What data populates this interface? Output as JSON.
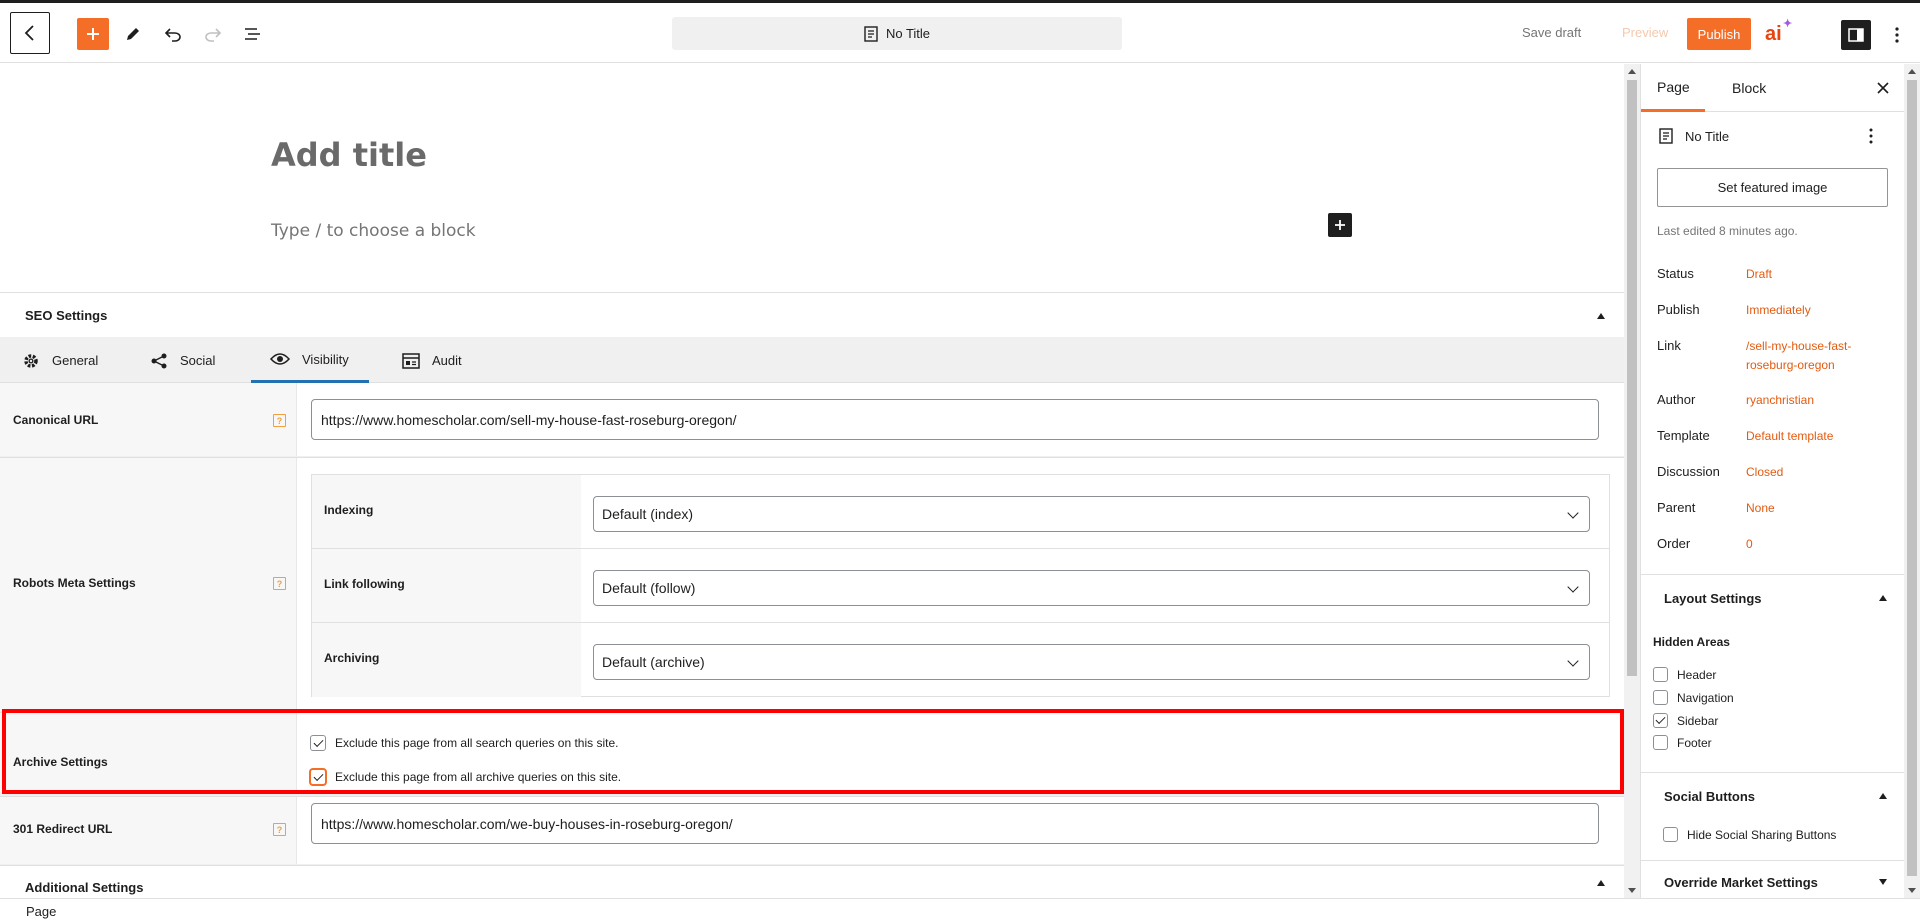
{
  "header": {
    "document_title": "No Title",
    "save_draft": "Save draft",
    "preview": "Preview",
    "publish": "Publish",
    "ai_logo": "ai",
    "accent_color": "#f56e28"
  },
  "editor": {
    "title_placeholder": "Add title",
    "block_placeholder": "Type / to choose a block"
  },
  "seo": {
    "section_title": "SEO Settings",
    "tabs": [
      {
        "label": "General",
        "icon": "gear-icon"
      },
      {
        "label": "Social",
        "icon": "share-icon"
      },
      {
        "label": "Visibility",
        "icon": "eye-icon",
        "active": true
      },
      {
        "label": "Audit",
        "icon": "audit-icon"
      }
    ],
    "canonical": {
      "label": "Canonical URL",
      "value": "https://www.homescholar.com/sell-my-house-fast-roseburg-oregon/"
    },
    "robots": {
      "label": "Robots Meta Settings",
      "rows": [
        {
          "label": "Indexing",
          "value": "Default (index)"
        },
        {
          "label": "Link following",
          "value": "Default (follow)"
        },
        {
          "label": "Archiving",
          "value": "Default (archive)"
        }
      ]
    },
    "archive": {
      "label": "Archive Settings",
      "options": [
        {
          "label": "Exclude this page from all search queries on this site.",
          "checked": true
        },
        {
          "label": "Exclude this page from all archive queries on this site.",
          "checked": true
        }
      ]
    },
    "redirect": {
      "label": "301 Redirect URL",
      "value": "https://www.homescholar.com/we-buy-houses-in-roseburg-oregon/"
    },
    "help_glyph": "?",
    "additional_title": "Additional Settings"
  },
  "sidebar": {
    "tabs": [
      "Page",
      "Block"
    ],
    "doc_title": "No Title",
    "featured_image": "Set featured image",
    "last_edited": "Last edited 8 minutes ago.",
    "props": [
      {
        "label": "Status",
        "value": "Draft"
      },
      {
        "label": "Publish",
        "value": "Immediately"
      },
      {
        "label": "Link",
        "value": "/sell-my-house-fast-roseburg-oregon"
      },
      {
        "label": "Author",
        "value": "ryanchristian"
      },
      {
        "label": "Template",
        "value": "Default template"
      },
      {
        "label": "Discussion",
        "value": "Closed"
      },
      {
        "label": "Parent",
        "value": "None"
      },
      {
        "label": "Order",
        "value": "0"
      }
    ],
    "layout": {
      "title": "Layout Settings",
      "hidden_areas_label": "Hidden Areas",
      "items": [
        {
          "label": "Header",
          "checked": false
        },
        {
          "label": "Navigation",
          "checked": false
        },
        {
          "label": "Sidebar",
          "checked": true
        },
        {
          "label": "Footer",
          "checked": false
        }
      ]
    },
    "social": {
      "title": "Social Buttons",
      "hide_label": "Hide Social Sharing Buttons"
    },
    "market": {
      "title": "Override Market Settings"
    }
  },
  "footer": {
    "breadcrumb": "Page"
  }
}
